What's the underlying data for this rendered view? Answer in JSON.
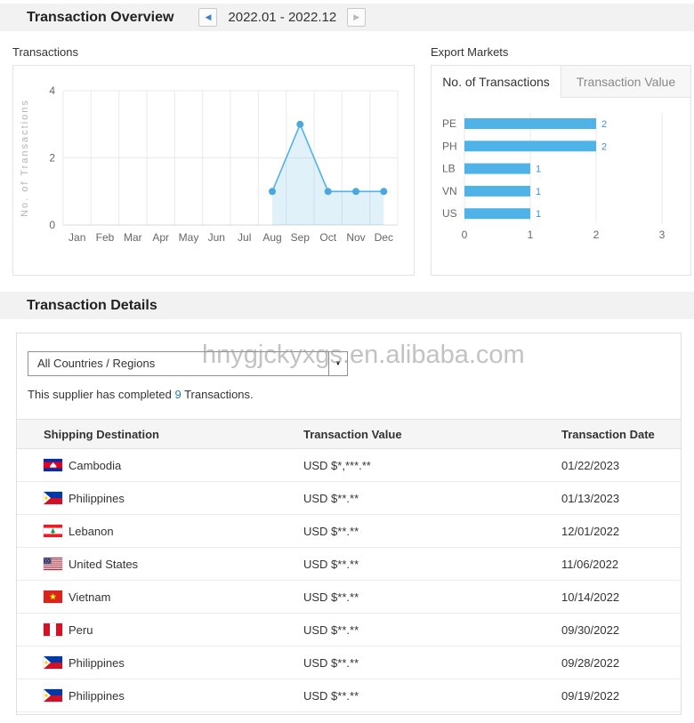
{
  "colors": {
    "bar_blue": "#4fb3e8",
    "line_blue": "#55b1e3",
    "value_label_blue": "#3d92d4",
    "link_blue": "#2878b8",
    "section_bar_bg": "#f2f2f2"
  },
  "header": {
    "title": "Transaction Overview",
    "prev_icon": "◀",
    "next_icon": "▶",
    "date_range": "2022.01 - 2022.12"
  },
  "export_markets": {
    "tabs": [
      {
        "label": "No. of Transactions",
        "active": true
      },
      {
        "label": "Transaction Value",
        "active": false
      }
    ]
  },
  "chart_data": [
    {
      "type": "area",
      "title": "Transactions",
      "x": [
        "Jan",
        "Feb",
        "Mar",
        "Apr",
        "May",
        "Jun",
        "Jul",
        "Aug",
        "Sep",
        "Oct",
        "Nov",
        "Dec"
      ],
      "values": [
        null,
        null,
        null,
        null,
        null,
        null,
        null,
        1,
        3,
        1,
        1,
        1
      ],
      "ylabel": "No. of Transactions",
      "yticks": [
        0,
        2,
        4
      ],
      "ylim": [
        0,
        4
      ],
      "grid": true,
      "legend": false
    },
    {
      "type": "bar",
      "orientation": "horizontal",
      "title": "Export Markets",
      "subtitle": "No. of Transactions",
      "categories": [
        "PE",
        "PH",
        "LB",
        "VN",
        "US"
      ],
      "values": [
        2,
        2,
        1,
        1,
        1
      ],
      "xticks": [
        0,
        1,
        2,
        3
      ],
      "xlim": [
        0,
        3
      ],
      "grid": true,
      "value_labels": true
    }
  ],
  "details": {
    "title": "Transaction Details",
    "watermark": "hnygjckyxgs.en.alibaba.com",
    "filter": {
      "value": "All Countries / Regions",
      "arrow_icon": "▼"
    },
    "summary": {
      "prefix": "This supplier has completed ",
      "count": "9",
      "suffix": " Transactions."
    },
    "table": {
      "columns": [
        "Shipping Destination",
        "Transaction Value",
        "Transaction Date"
      ],
      "rows": [
        {
          "flag": "kh",
          "country": "Cambodia",
          "value": "USD $*,***.**",
          "date": "01/22/2023"
        },
        {
          "flag": "ph",
          "country": "Philippines",
          "value": "USD $**.**",
          "date": "01/13/2023"
        },
        {
          "flag": "lb",
          "country": "Lebanon",
          "value": "USD $**.**",
          "date": "12/01/2022"
        },
        {
          "flag": "us",
          "country": "United States",
          "value": "USD $**.**",
          "date": "11/06/2022"
        },
        {
          "flag": "vn",
          "country": "Vietnam",
          "value": "USD $**.**",
          "date": "10/14/2022"
        },
        {
          "flag": "pe",
          "country": "Peru",
          "value": "USD $**.**",
          "date": "09/30/2022"
        },
        {
          "flag": "ph",
          "country": "Philippines",
          "value": "USD $**.**",
          "date": "09/28/2022"
        },
        {
          "flag": "ph",
          "country": "Philippines",
          "value": "USD $**.**",
          "date": "09/19/2022"
        }
      ]
    }
  }
}
